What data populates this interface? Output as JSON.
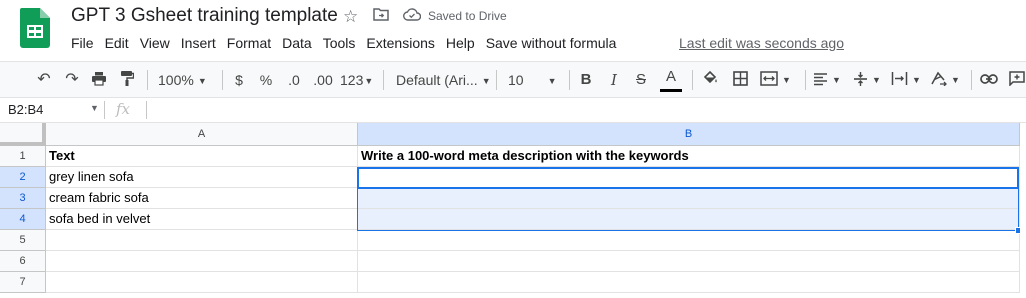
{
  "app": {
    "title": "GPT 3 Gsheet training template",
    "saved_status": "Saved to Drive",
    "last_edit": "Last edit was seconds ago"
  },
  "menu": [
    "File",
    "Edit",
    "View",
    "Insert",
    "Format",
    "Data",
    "Tools",
    "Extensions",
    "Help",
    "Save without formula"
  ],
  "toolbar": {
    "zoom": "100%",
    "currency": "$",
    "percent": "%",
    "decrease_decimal": ".0",
    "increase_decimal": ".00",
    "more_formats": "123",
    "font_family": "Default (Ari...",
    "font_size": "10",
    "bold": "B",
    "italic": "I",
    "strikethrough": "S",
    "text_color": "A"
  },
  "formula_bar": {
    "name_box": "B2:B4",
    "fx": "fx",
    "value": ""
  },
  "columns": [
    "A",
    "B"
  ],
  "rows": [
    {
      "num": "1",
      "a": "Text",
      "b": "Write a 100-word meta description with the keywords"
    },
    {
      "num": "2",
      "a": "grey linen sofa",
      "b": ""
    },
    {
      "num": "3",
      "a": "cream fabric sofa",
      "b": ""
    },
    {
      "num": "4",
      "a": "sofa bed in velvet",
      "b": ""
    },
    {
      "num": "5",
      "a": "",
      "b": ""
    },
    {
      "num": "6",
      "a": "",
      "b": ""
    },
    {
      "num": "7",
      "a": "",
      "b": ""
    }
  ],
  "selection": "B2:B4",
  "colors": {
    "brand_green": "#0f9d58",
    "selection_blue": "#1a73e8",
    "range_fill": "#e8f0fe"
  }
}
